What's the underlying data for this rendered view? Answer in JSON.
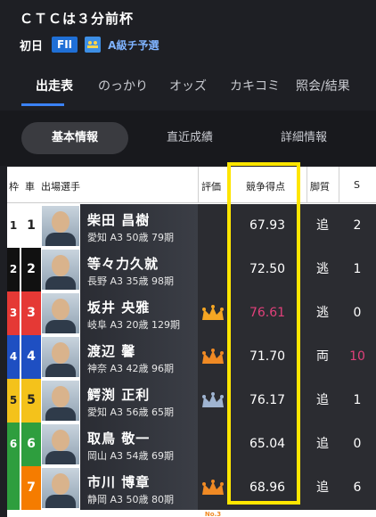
{
  "race": {
    "title": "ＣＴＣは３分前杯",
    "day": "初日",
    "grade": "FII",
    "type": "A級チ予選"
  },
  "tabs": [
    "出走表",
    "のっかり",
    "オッズ",
    "カキコミ",
    "照会/結果"
  ],
  "subtabs": [
    "基本情報",
    "直近成績",
    "詳細情報"
  ],
  "table": {
    "headers": {
      "frame": "枠",
      "car": "車",
      "player": "出場選手",
      "rating": "評価",
      "score": "競争得点",
      "style": "脚質",
      "s": "S"
    },
    "rows": [
      {
        "frame": "1",
        "car": "1",
        "name": "柴田 昌樹",
        "info": "愛知 A3 50歳 79期",
        "rating": "",
        "score": "67.93",
        "style": "追",
        "s": "2"
      },
      {
        "frame": "2",
        "car": "2",
        "name": "等々力久就",
        "info": "長野 A3 35歳 98期",
        "rating": "",
        "score": "72.50",
        "style": "逃",
        "s": "1"
      },
      {
        "frame": "3",
        "car": "3",
        "name": "坂井 央雅",
        "info": "岐阜 A3 20歳 129期",
        "rating": "No.1",
        "score": "76.61",
        "style": "逃",
        "s": "0"
      },
      {
        "frame": "4",
        "car": "4",
        "name": "渡辺 馨",
        "info": "神奈 A3 42歳 96期",
        "rating": "No.3",
        "score": "71.70",
        "style": "両",
        "s": "10"
      },
      {
        "frame": "5",
        "car": "5",
        "name": "鰐渕 正利",
        "info": "愛知 A3 56歳 65期",
        "rating": "No.2",
        "score": "76.17",
        "style": "追",
        "s": "1"
      },
      {
        "frame": "6",
        "car": "6",
        "name": "取鳥 敬一",
        "info": "岡山 A3 54歳 69期",
        "rating": "",
        "score": "65.04",
        "style": "追",
        "s": "0"
      },
      {
        "frame": "",
        "car": "7",
        "name": "市川 博章",
        "info": "静岡 A3 50歳 80期",
        "rating": "No.3",
        "score": "68.96",
        "style": "追",
        "s": "6"
      }
    ]
  },
  "colors": {
    "frame_1": "#ffffff",
    "frame_2": "#111111",
    "frame_3": "#e53935",
    "frame_4": "#1e4fc2",
    "frame_5": "#f4c21b",
    "frame_6": "#2e9e3e",
    "frame_7": "#f57c00",
    "highlight": "#ffe600",
    "top_score": "#e0407a",
    "s_high": "#e0407a"
  }
}
